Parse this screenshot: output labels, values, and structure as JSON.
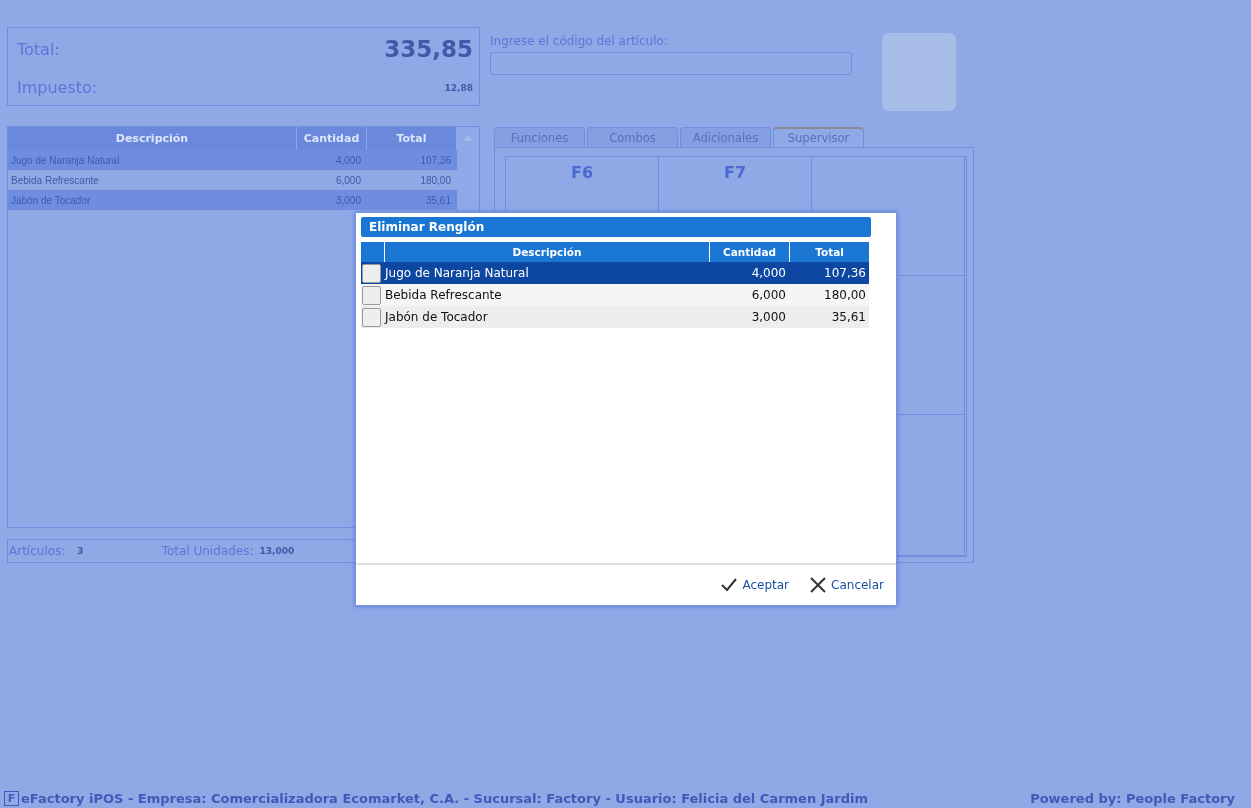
{
  "summary": {
    "total_label": "Total:",
    "total_value": "335,85",
    "tax_label": "Impuesto:",
    "tax_value": "12,88"
  },
  "code_entry": {
    "label": "Ingrese el código del artículo:"
  },
  "items_table": {
    "columns": [
      "Descripción",
      "Cantidad",
      "Total"
    ],
    "rows": [
      {
        "description": "Jugo de Naranja Natural",
        "quantity": "4,000",
        "total": "107,36"
      },
      {
        "description": "Bebida Refrescante",
        "quantity": "6,000",
        "total": "180,00"
      },
      {
        "description": "Jabón de Tocador",
        "quantity": "3,000",
        "total": "35,61"
      }
    ]
  },
  "items_footer": {
    "articles_label": "Artículos:",
    "articles_value": "3",
    "units_label": "Total Unidades:",
    "units_value": "13,000"
  },
  "tabs": [
    {
      "label": "Funciones",
      "selected": false
    },
    {
      "label": "Combos",
      "selected": false
    },
    {
      "label": "Adicionales",
      "selected": false
    },
    {
      "label": "Supervisor",
      "selected": true
    }
  ],
  "function_keys": [
    "F6",
    "F7"
  ],
  "dialog": {
    "title": "Eliminar Renglón",
    "columns": [
      "Descripción",
      "Cantidad",
      "Total"
    ],
    "rows": [
      {
        "description": "Jugo de Naranja Natural",
        "quantity": "4,000",
        "total": "107,36",
        "checked": false,
        "selected": true
      },
      {
        "description": "Bebida Refrescante",
        "quantity": "6,000",
        "total": "180,00",
        "checked": false,
        "selected": false
      },
      {
        "description": "Jabón de Tocador",
        "quantity": "3,000",
        "total": "35,61",
        "checked": false,
        "selected": false
      }
    ],
    "buttons": [
      {
        "kind": "accept",
        "label": "Aceptar"
      },
      {
        "kind": "cancel",
        "label": "Cancelar"
      }
    ]
  },
  "status_bar": {
    "logo": "F",
    "text": "eFactory iPOS - Empresa: Comercializadora Ecomarket, C.A. - Sucursal: Factory - Usuario: Felicia del Carmen Jardim",
    "powered": "Powered by: People Factory"
  }
}
